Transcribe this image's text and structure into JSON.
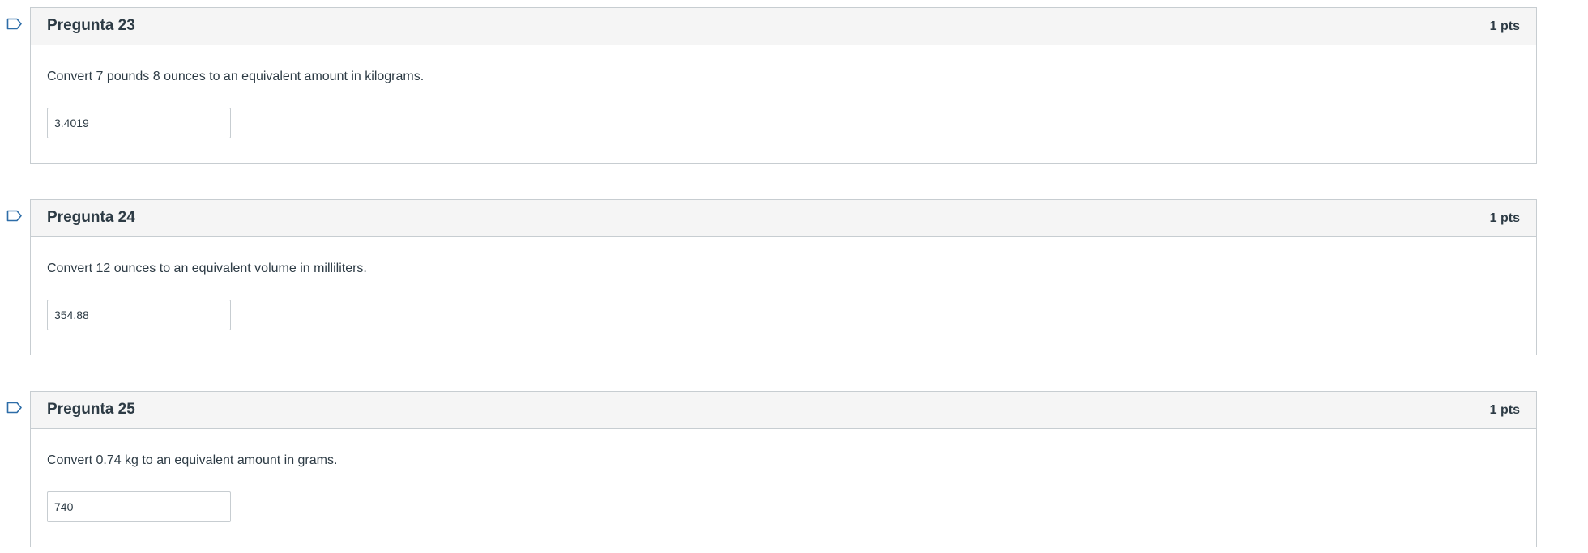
{
  "questions": [
    {
      "title": "Pregunta 23",
      "points": "1 pts",
      "text": "Convert 7 pounds 8 ounces to an equivalent amount in kilograms.",
      "answer": "3.4019",
      "flag_icon": "bookmark-flag-icon"
    },
    {
      "title": "Pregunta 24",
      "points": "1 pts",
      "text": "Convert 12 ounces to an equivalent volume in milliliters.",
      "answer": "354.88",
      "flag_icon": "bookmark-flag-icon"
    },
    {
      "title": "Pregunta 25",
      "points": "1 pts",
      "text": "Convert 0.74 kg to an equivalent amount in grams.",
      "answer": "740",
      "flag_icon": "bookmark-flag-icon"
    }
  ],
  "colors": {
    "border": "#c7cdd1",
    "header_bg": "#f5f5f5",
    "text": "#2d3b45",
    "flag": "#2d6da8"
  }
}
